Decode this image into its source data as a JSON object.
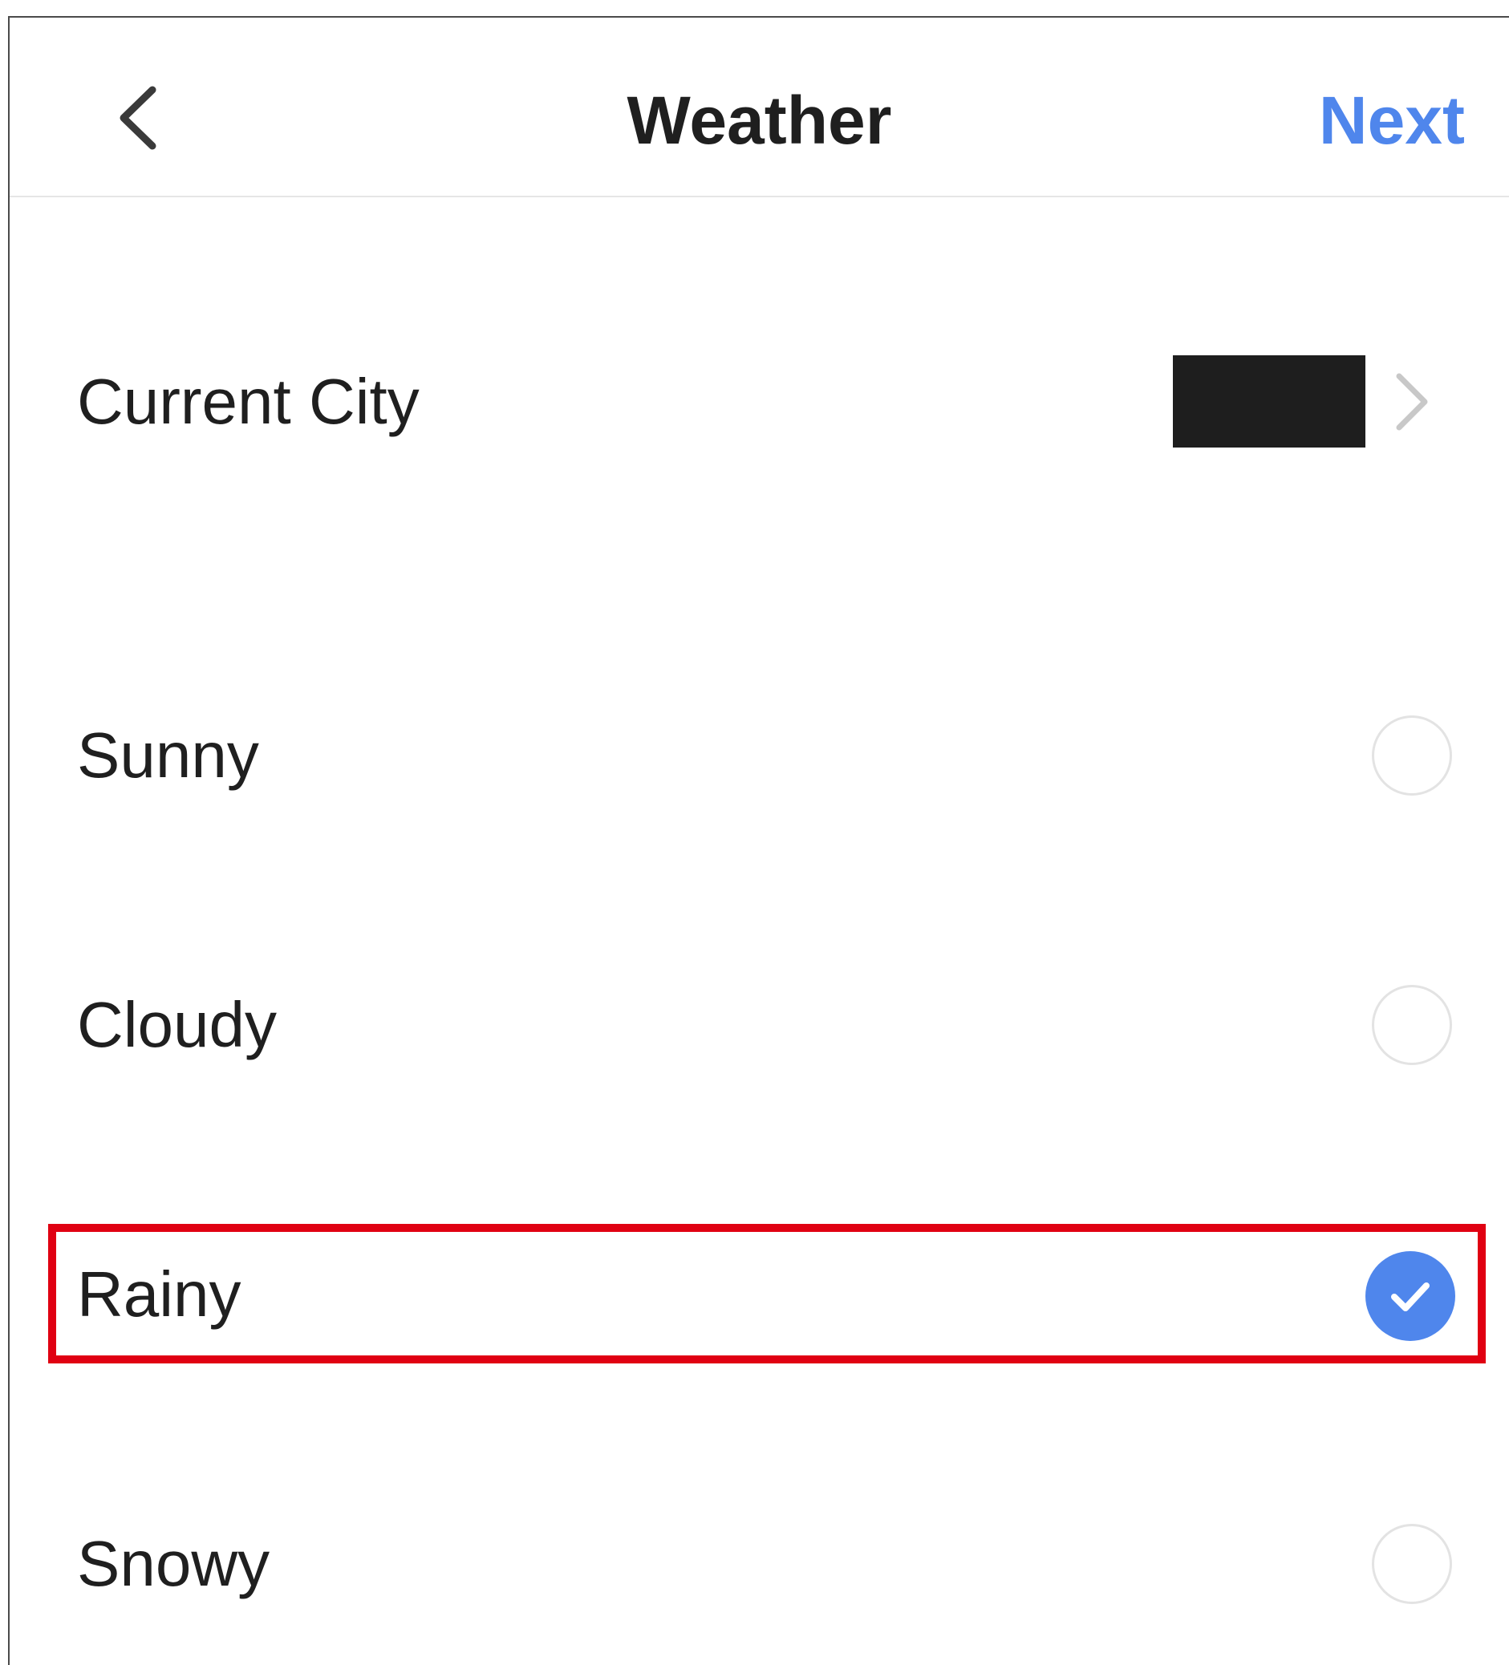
{
  "header": {
    "title": "Weather",
    "next_label": "Next",
    "back_icon": "chevron-left-icon"
  },
  "current_city": {
    "label": "Current City",
    "value": "",
    "value_redacted": true,
    "chevron_icon": "chevron-right-icon"
  },
  "options": [
    {
      "label": "Sunny",
      "selected": false
    },
    {
      "label": "Cloudy",
      "selected": false
    },
    {
      "label": "Rainy",
      "selected": true
    },
    {
      "label": "Snowy",
      "selected": false
    }
  ],
  "colors": {
    "accent": "#4f86ec",
    "highlight": "#e00012",
    "text": "#1f1f1f",
    "divider": "#e6e6e6",
    "radio_border": "#e3e3e3"
  }
}
